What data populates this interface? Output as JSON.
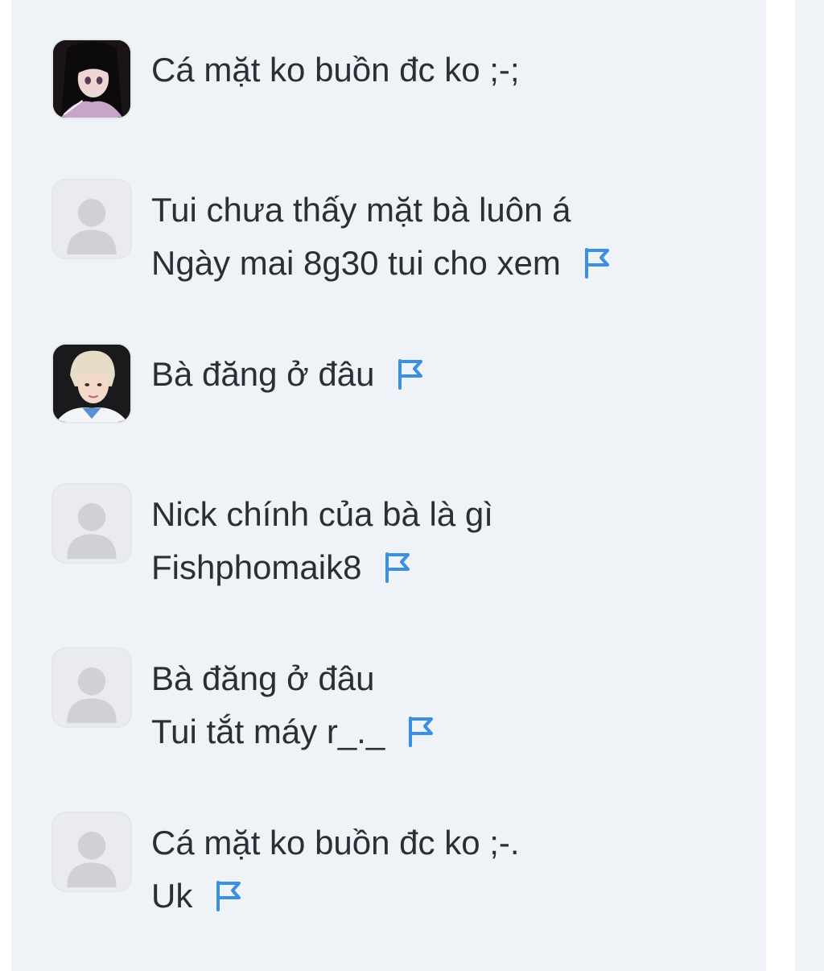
{
  "colors": {
    "panel_background": "#eff3f8",
    "text": "#2a2f36",
    "flag": "#3a8fe0",
    "default_avatar_bg": "#e9ebee",
    "default_avatar_silhouette": "#cfd1d4"
  },
  "comments": [
    {
      "avatar": "anime-girl-avatar",
      "lines": [
        "Cá mặt ko buồn đc  ko ;-;"
      ],
      "has_flag": false
    },
    {
      "avatar": "default-user-avatar",
      "lines": [
        "Tui chưa thấy mặt bà luôn á",
        "Ngày mai 8g30 tui cho xem"
      ],
      "has_flag": true
    },
    {
      "avatar": "blond-boy-avatar",
      "lines": [
        "Bà đăng ở đâu"
      ],
      "has_flag": true
    },
    {
      "avatar": "default-user-avatar",
      "lines": [
        "Nick chính của bà là gì",
        "Fishphomaik8"
      ],
      "has_flag": true
    },
    {
      "avatar": "default-user-avatar",
      "lines": [
        "Bà đăng ở đâu",
        "Tui tắt máy r_._"
      ],
      "has_flag": true
    },
    {
      "avatar": "default-user-avatar",
      "lines": [
        "Cá mặt ko buồn đc  ko ;-.",
        "Uk"
      ],
      "has_flag": true
    }
  ]
}
